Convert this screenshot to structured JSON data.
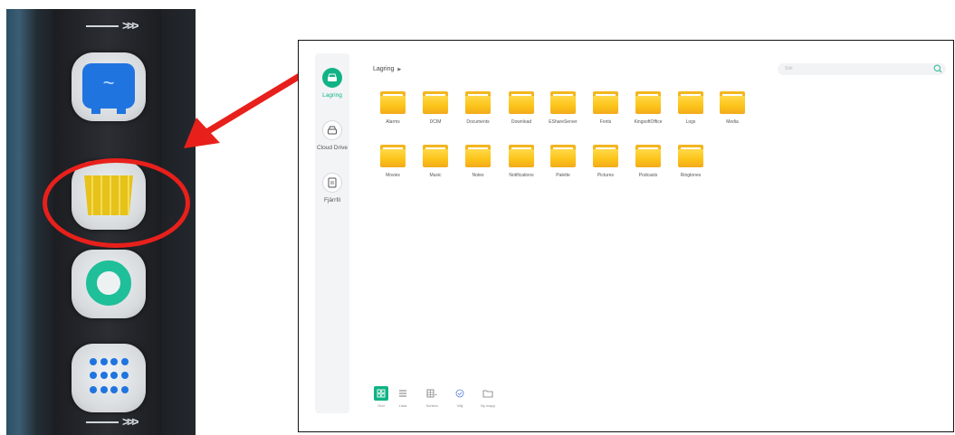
{
  "photo": {
    "chevron_text": ">>>",
    "apps": [
      {
        "icon": "monitor-wave-icon"
      },
      {
        "icon": "basket-icon"
      },
      {
        "icon": "ring-icon"
      },
      {
        "icon": "app-grid-icon"
      }
    ],
    "highlight_color": "#e8201b"
  },
  "file_manager": {
    "accent": "#11b386",
    "sidebar": {
      "items": [
        {
          "label": "Lagring",
          "icon": "storage-icon",
          "active": true
        },
        {
          "label": "Cloud Drive",
          "icon": "cloud-drive-icon",
          "active": false
        },
        {
          "label": "Fjärrfil",
          "icon": "remote-file-icon",
          "active": false
        }
      ]
    },
    "breadcrumb": {
      "label": "Lagring",
      "caret": "▶"
    },
    "search": {
      "placeholder": "Sök"
    },
    "folders": [
      {
        "name": "Alarms"
      },
      {
        "name": "DCIM"
      },
      {
        "name": "Documents"
      },
      {
        "name": "Download"
      },
      {
        "name": "EShareServer"
      },
      {
        "name": "Fonts"
      },
      {
        "name": "KingsoftOffice"
      },
      {
        "name": "Logs"
      },
      {
        "name": "Media"
      },
      {
        "name": "Movies"
      },
      {
        "name": "Music"
      },
      {
        "name": "Notes"
      },
      {
        "name": "Notifications"
      },
      {
        "name": "Palette"
      },
      {
        "name": "Pictures"
      },
      {
        "name": "Podcasts"
      },
      {
        "name": "Ringtones"
      }
    ],
    "toolbar": {
      "buttons": [
        {
          "label": "Grid",
          "icon": "grid-view-icon",
          "active": true
        },
        {
          "label": "Lista",
          "icon": "list-view-icon",
          "active": false
        },
        {
          "label": "Sortera",
          "icon": "sort-icon",
          "active": false
        },
        {
          "label": "Välj",
          "icon": "select-check-icon",
          "active": false
        },
        {
          "label": "Ny mapp",
          "icon": "new-folder-icon",
          "active": false
        }
      ]
    }
  }
}
